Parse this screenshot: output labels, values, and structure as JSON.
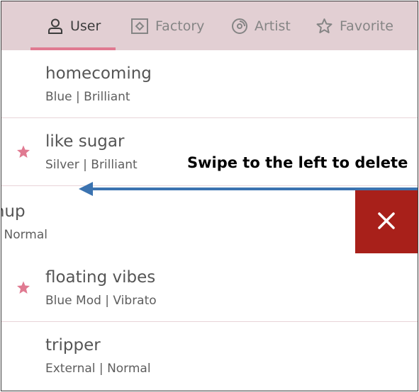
{
  "tabs": [
    {
      "label": "User",
      "icon": "user-icon",
      "active": true
    },
    {
      "label": "Factory",
      "icon": "factory-icon",
      "active": false
    },
    {
      "label": "Artist",
      "icon": "disc-icon",
      "active": false
    },
    {
      "label": "Favorite",
      "icon": "star-outline-icon",
      "active": false
    }
  ],
  "colors": {
    "tabbar_bg": "#e2cfd3",
    "tab_indicator": "#e07a91",
    "favorite_star": "#e07a91",
    "delete_bg": "#a8201a",
    "arrow": "#3b73b0"
  },
  "list": [
    {
      "title": "homecoming",
      "subtitle": "Blue | Brilliant",
      "favorite": false
    },
    {
      "title": "like sugar",
      "subtitle": "Silver | Brilliant",
      "favorite": true
    },
    {
      "title": "Catchup",
      "subtitle": "Stitch | Normal",
      "favorite": false,
      "swiped": true
    },
    {
      "title": "floating vibes",
      "subtitle": "Blue Mod | Vibrato",
      "favorite": true
    },
    {
      "title": "tripper",
      "subtitle": "External | Normal",
      "favorite": false
    }
  ],
  "annotation": {
    "text": "Swipe to the left to delete"
  },
  "delete_action": {
    "icon": "close-icon"
  }
}
